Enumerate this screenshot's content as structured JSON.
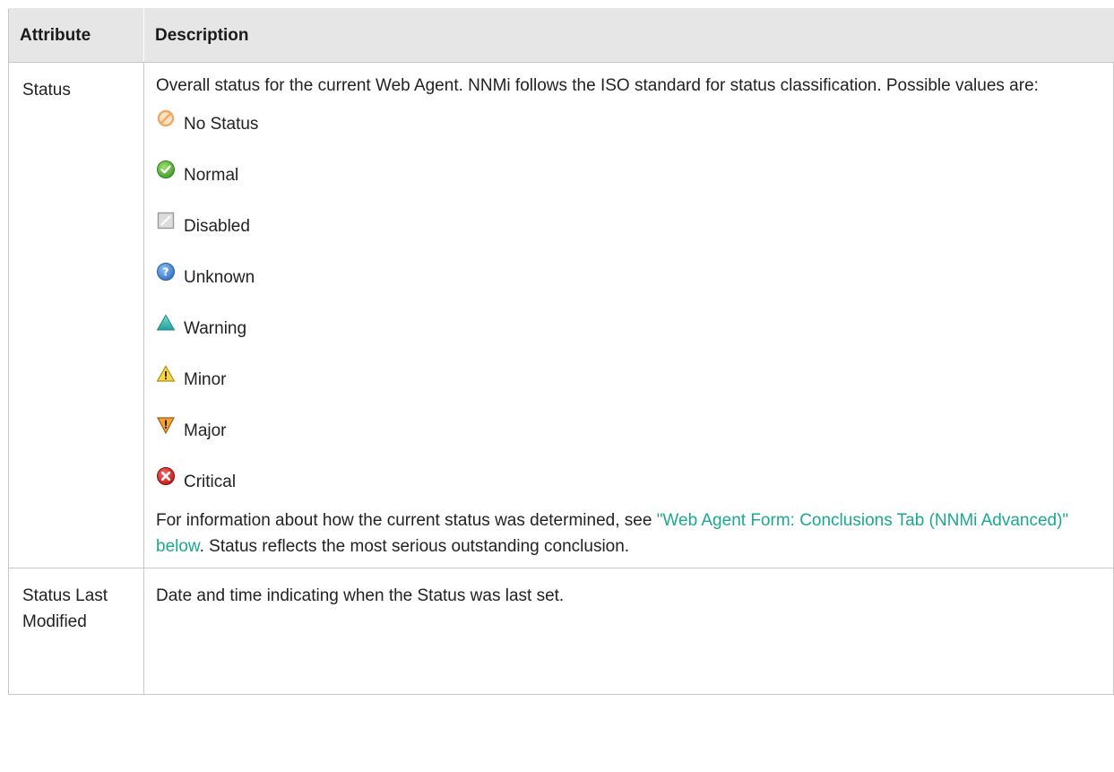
{
  "table": {
    "headers": [
      "Attribute",
      "Description"
    ],
    "status_row": {
      "attribute": "Status",
      "intro": "Overall status for the current Web Agent. NNMi follows the ISO standard for status classification. Possible values are:",
      "statuses": [
        {
          "label": "No Status",
          "icon": "no-status-icon"
        },
        {
          "label": "Normal",
          "icon": "normal-icon"
        },
        {
          "label": "Disabled",
          "icon": "disabled-icon"
        },
        {
          "label": "Unknown",
          "icon": "unknown-icon"
        },
        {
          "label": "Warning",
          "icon": "warning-icon"
        },
        {
          "label": "Minor",
          "icon": "minor-icon"
        },
        {
          "label": "Major",
          "icon": "major-icon"
        },
        {
          "label": "Critical",
          "icon": "critical-icon"
        }
      ],
      "footer_before": "For information about how the current status was determined, see ",
      "footer_link": "\"Web Agent Form: Conclusions Tab (NNMi Advanced)\" below",
      "footer_after": ". Status reflects the most serious outstanding conclusion."
    },
    "modified_row": {
      "attribute": "Status Last Modified",
      "description": "Date and time indicating when the Status was last set."
    }
  },
  "colors": {
    "link": "#1ba890",
    "header_bg": "#e6e6e6",
    "border": "#c8c8c8"
  }
}
